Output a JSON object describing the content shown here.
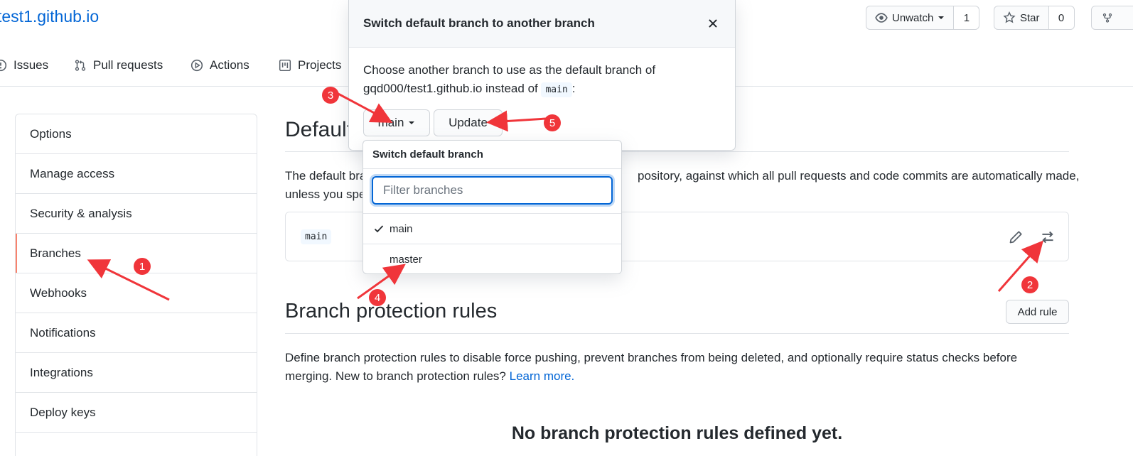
{
  "header": {
    "repo_title": "test1.github.io",
    "unwatch": {
      "label": "Unwatch",
      "count": "1"
    },
    "star": {
      "label": "Star",
      "count": "0"
    }
  },
  "tabs": [
    {
      "label": "Issues",
      "icon": "issue-icon"
    },
    {
      "label": "Pull requests",
      "icon": "pull-request-icon"
    },
    {
      "label": "Actions",
      "icon": "play-icon"
    },
    {
      "label": "Projects",
      "icon": "project-icon"
    }
  ],
  "sidebar": {
    "items": [
      {
        "label": "Options"
      },
      {
        "label": "Manage access"
      },
      {
        "label": "Security & analysis"
      },
      {
        "label": "Branches",
        "active": true
      },
      {
        "label": "Webhooks"
      },
      {
        "label": "Notifications"
      },
      {
        "label": "Integrations"
      },
      {
        "label": "Deploy keys"
      }
    ]
  },
  "main": {
    "default_branch": {
      "title_visible": "Default",
      "desc_line1_start": "The default bra",
      "desc_line1_end": "pository, against which all pull requests and code commits are automatically made,",
      "desc_line2_start": "unless you spe",
      "branch": "main"
    },
    "protection": {
      "title": "Branch protection rules",
      "add_rule": "Add rule",
      "desc": "Define branch protection rules to disable force pushing, prevent branches from being deleted, and optionally require status checks before merging. New to branch protection rules?",
      "learn_more": "Learn more.",
      "empty_title": "No branch protection rules defined yet."
    }
  },
  "modal": {
    "title": "Switch default branch to another branch",
    "body_text": "Choose another branch to use as the default branch of gqd000/test1.github.io instead of",
    "body_code": "main",
    "body_suffix": ":",
    "branch_button": "main",
    "update_button": "Update"
  },
  "dropdown": {
    "header": "Switch default branch",
    "filter_placeholder": "Filter branches",
    "items": [
      {
        "label": "main",
        "selected": true
      },
      {
        "label": "master",
        "selected": false
      }
    ]
  },
  "annotations": [
    "1",
    "2",
    "3",
    "4",
    "5"
  ],
  "colors": {
    "accent": "#0366d6",
    "annotation": "#f0353a",
    "active_indicator": "#f9826c"
  }
}
